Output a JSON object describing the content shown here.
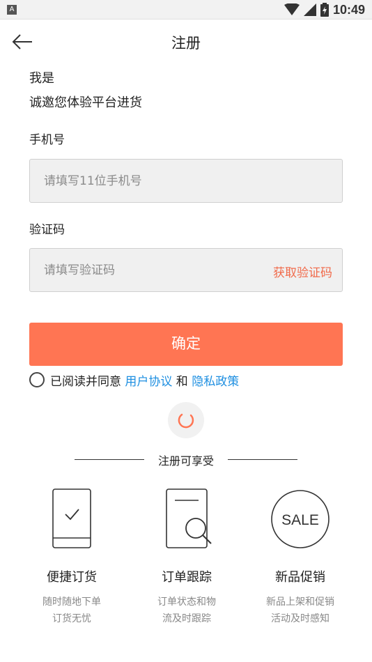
{
  "status_bar": {
    "app_icon_letter": "A",
    "time": "10:49"
  },
  "nav": {
    "title": "注册"
  },
  "intro": {
    "line1": "我是",
    "line2": "诚邀您体验平台进货"
  },
  "phone": {
    "label": "手机号",
    "placeholder": "请填写11位手机号",
    "value": ""
  },
  "code": {
    "label": "验证码",
    "placeholder": "请填写验证码",
    "value": "",
    "get_code_label": "获取验证码"
  },
  "confirm_label": "确定",
  "agreement": {
    "prefix": "已阅读并同意 ",
    "user_agreement": "用户协议",
    "and": " 和 ",
    "privacy_policy": "隐私政策",
    "checked": false
  },
  "benefits": {
    "heading": "注册可享受",
    "items": [
      {
        "icon": "phone-check-icon",
        "title": "便捷订货",
        "desc_line1": "随时随地下单",
        "desc_line2": "订货无忧"
      },
      {
        "icon": "document-search-icon",
        "title": "订单跟踪",
        "desc_line1": "订单状态和物",
        "desc_line2": "流及时跟踪"
      },
      {
        "icon": "sale-badge-icon",
        "badge_text": "SALE",
        "title": "新品促销",
        "desc_line1": "新品上架和促销",
        "desc_line2": "活动及时感知"
      }
    ]
  },
  "colors": {
    "accent": "#ff7553",
    "link": "#1e8fe1",
    "get_code": "#f16a4a"
  }
}
